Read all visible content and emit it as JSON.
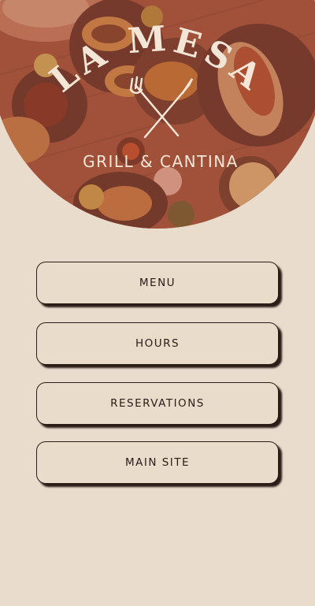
{
  "brand": {
    "name_part1": "LA",
    "name_part2": "MESA",
    "tagline": "GRILL & CANTINA"
  },
  "buttons": {
    "menu": "MENU",
    "hours": "HOURS",
    "reservations": "RESERVATIONS",
    "main_site": "MAIN SITE"
  },
  "colors": {
    "background": "#e9dccd",
    "hero_overlay": "#a4563e",
    "text_dark": "#2a1c16",
    "logo_light": "#f3e6d6"
  }
}
